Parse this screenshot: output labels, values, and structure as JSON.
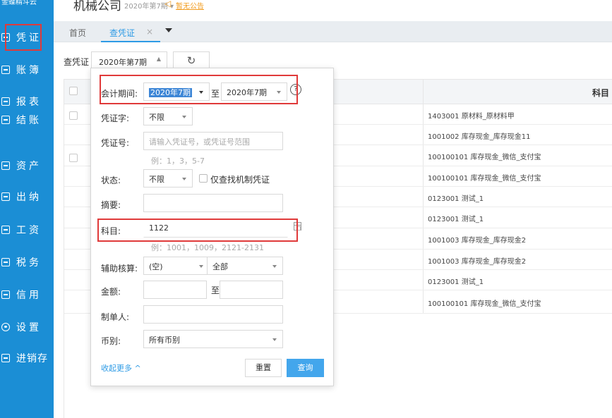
{
  "sidebar": {
    "logo": "金蝶精斗云",
    "items": [
      {
        "label": "凭证",
        "icon": "voucher-icon"
      },
      {
        "label": "账簿",
        "icon": "ledger-icon"
      },
      {
        "label": "报表",
        "icon": "report-icon"
      },
      {
        "label": "结账",
        "icon": "close-account-icon"
      },
      {
        "label": "资产",
        "icon": "asset-icon"
      },
      {
        "label": "出纳",
        "icon": "cashier-icon"
      },
      {
        "label": "工资",
        "icon": "salary-icon"
      },
      {
        "label": "税务",
        "icon": "tax-icon"
      },
      {
        "label": "信用",
        "icon": "credit-icon"
      },
      {
        "label": "设置",
        "icon": "gear-icon"
      },
      {
        "label": "进销存",
        "icon": "inventory-icon"
      }
    ]
  },
  "header": {
    "company": "机械公司",
    "period": "2020年第7期 ▾",
    "notice": "暂无公告"
  },
  "tabs": {
    "home": "首页",
    "active": "查凭证",
    "close": "×"
  },
  "query_bar": {
    "label": "查凭证",
    "period": "2020年第7期",
    "refresh": "↻"
  },
  "table": {
    "header_subject": "科目",
    "rows": [
      "1403001 原材料_原材料甲",
      "1001002 库存现金_库存现金11",
      "100100101 库存现金_微信_支付宝",
      "100100101 库存现金_微信_支付宝",
      "0123001 测试_1",
      "0123001 测试_1",
      "1001003 库存现金_库存现金2",
      "1001003 库存现金_库存现金2",
      "0123001 测试_1",
      "100100101 库存现金_微信_支付宝"
    ]
  },
  "filter": {
    "period_label": "会计期间:",
    "period_from": "2020年7期",
    "period_to_label": "至",
    "period_to": "2020年7期",
    "voucher_word_label": "凭证字:",
    "voucher_word": "不限",
    "voucher_no_label": "凭证号:",
    "voucher_no_placeholder": "请输入凭证号，或凭证号范围",
    "voucher_no_hint": "例：1，3，5-7",
    "status_label": "状态:",
    "status": "不限",
    "only_machine_label": "仅查找机制凭证",
    "summary_label": "摘要:",
    "summary": "",
    "subject_label": "科目:",
    "subject": "1122",
    "subject_hint": "例：1001，1009，2121-2131",
    "aux_label": "辅助核算:",
    "aux_type": "(空)",
    "aux_value": "全部",
    "amount_label": "金额:",
    "amount_to_label": "至",
    "maker_label": "制单人:",
    "currency_label": "币别:",
    "currency": "所有币别",
    "collapse": "收起更多 ^",
    "reset": "重置",
    "query": "查询"
  }
}
